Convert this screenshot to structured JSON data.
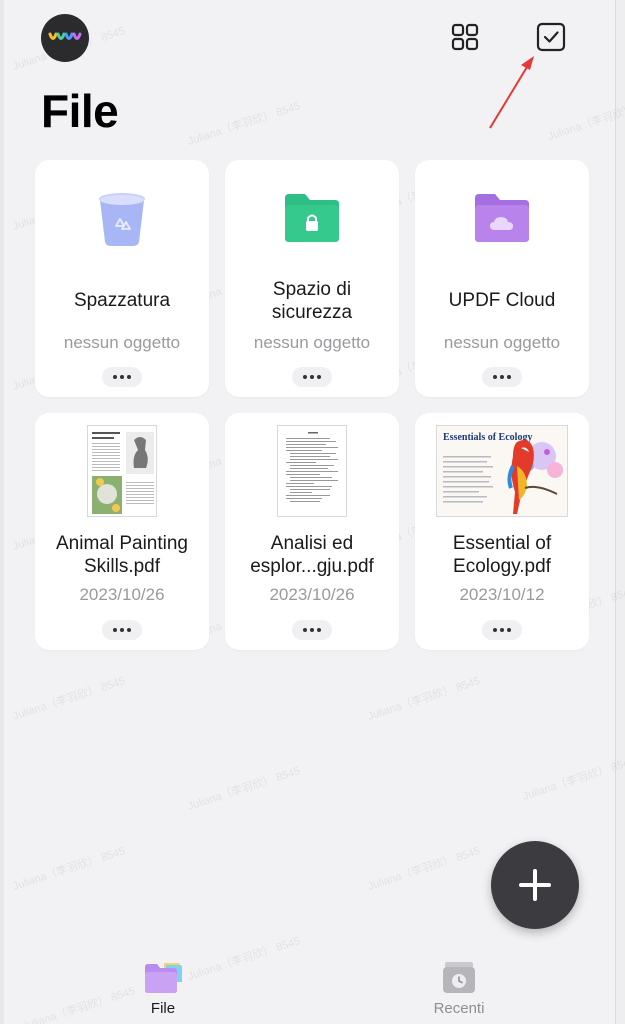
{
  "header": {
    "title": "File",
    "avatar_icon": "colorful-wave-logo",
    "grid_view_icon": "grid-view-icon",
    "select_icon": "checkbox-select-icon",
    "annotation": "red-arrow-pointer"
  },
  "folders": [
    {
      "name": "Spazzatura",
      "subtitle": "nessun oggetto",
      "icon": "trash-icon"
    },
    {
      "name": "Spazio di sicurezza",
      "subtitle": "nessun oggetto",
      "icon": "secure-folder-icon"
    },
    {
      "name": "UPDF Cloud",
      "subtitle": "nessun oggetto",
      "icon": "cloud-folder-icon"
    }
  ],
  "files": [
    {
      "name": "Animal Painting Skills.pdf",
      "date": "2023/10/26"
    },
    {
      "name": "Analisi ed esplor...gju.pdf",
      "date": "2023/10/26"
    },
    {
      "name": "Essential of Ecology.pdf",
      "date": "2023/10/12",
      "thumb_title": "Essentials of Ecology"
    }
  ],
  "fab": {
    "icon": "plus-icon"
  },
  "tabs": [
    {
      "label": "File",
      "icon": "folder-icon",
      "active": true
    },
    {
      "label": "Recenti",
      "icon": "recent-clock-icon",
      "active": false
    }
  ],
  "watermark": "Juliana（李羽欣） 8545",
  "colors": {
    "background": "#f2f2f5",
    "card": "#ffffff",
    "secure_green": "#2fbf86",
    "cloud_purple": "#b07fe6",
    "trash_blue": "#a9b6f5",
    "fab": "#3c3c40",
    "arrow": "#e53935"
  }
}
